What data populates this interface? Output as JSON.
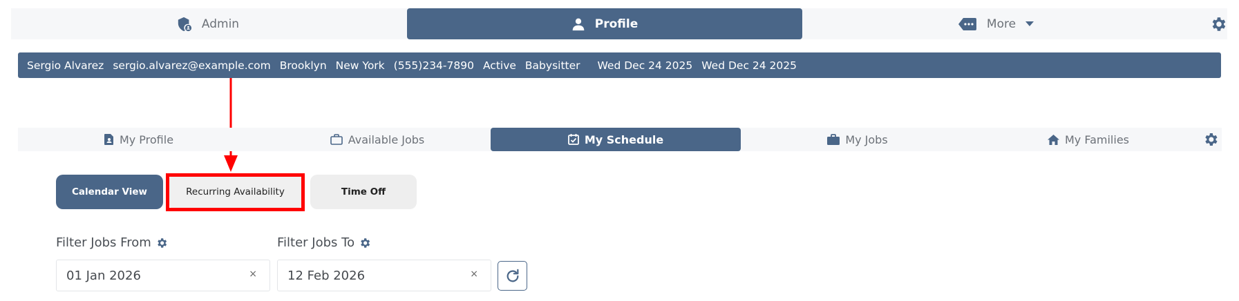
{
  "colors": {
    "primary": "#4a6688",
    "highlight": "#ff0000",
    "nav_bg": "#f6f7f9"
  },
  "topnav": {
    "admin_label": "Admin",
    "profile_label": "Profile",
    "more_label": "More"
  },
  "infobar": {
    "name": "Sergio Alvarez",
    "email": "sergio.alvarez@example.com",
    "city": "Brooklyn",
    "state": "New York",
    "phone": "(555)234-7890",
    "status": "Active",
    "role": "Babysitter",
    "date1": "Wed Dec 24 2025",
    "date2": "Wed Dec 24 2025"
  },
  "subnav": {
    "my_profile": "My Profile",
    "available_jobs": "Available Jobs",
    "my_schedule": "My Schedule",
    "my_jobs": "My Jobs",
    "my_families": "My Families"
  },
  "views": {
    "calendar": "Calendar View",
    "recurring": "Recurring Availability",
    "time_off": "Time Off"
  },
  "filters": {
    "from_label": "Filter Jobs From",
    "to_label": "Filter Jobs To",
    "from_value": "01 Jan 2026",
    "to_value": "12 Feb 2026",
    "clear_glyph": "×"
  }
}
